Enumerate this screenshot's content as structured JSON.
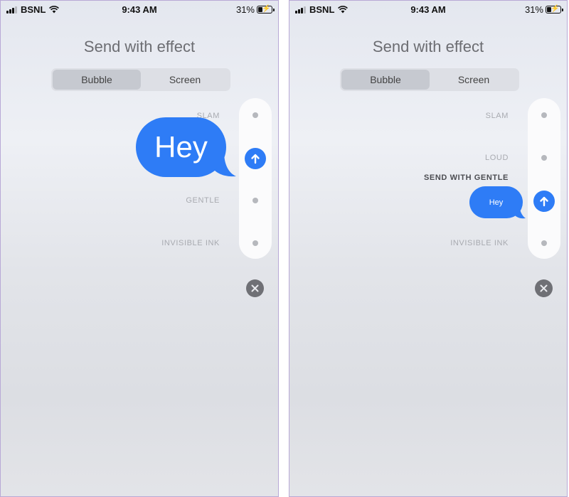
{
  "status_bar": {
    "carrier": "BSNL",
    "time": "9:43 AM",
    "battery": "31%"
  },
  "header": {
    "title": "Send with effect"
  },
  "tabs": [
    {
      "label": "Bubble",
      "selected": true
    },
    {
      "label": "Screen",
      "selected": false
    }
  ],
  "left_screen": {
    "effects": {
      "slam": "SLAM",
      "gentle": "GENTLE",
      "invisible_ink": "INVISIBLE INK"
    },
    "bubble_text": "Hey"
  },
  "right_screen": {
    "effects": {
      "slam": "SLAM",
      "loud": "LOUD",
      "invisible_ink": "INVISIBLE INK"
    },
    "selected_effect_caption": "SEND WITH GENTLE",
    "bubble_text": "Hey"
  },
  "colors": {
    "accent": "#2e7cf6",
    "close_button": "#6f7075"
  },
  "icons": {
    "send": "arrow-up-icon",
    "close": "close-icon",
    "wifi": "wifi-icon",
    "battery": "battery-charging-icon"
  }
}
